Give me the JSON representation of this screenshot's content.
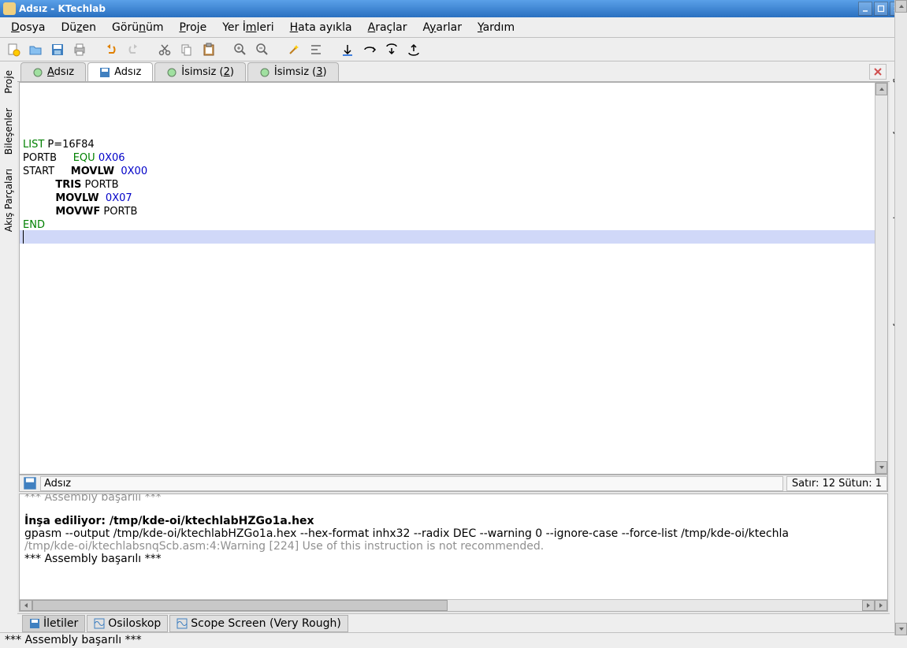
{
  "window": {
    "title": "Adsız - KTechlab"
  },
  "menus": {
    "file": "Dosya",
    "edit": "Düzen",
    "view": "Görünüm",
    "project": "Proje",
    "bookmarks": "Yer İmleri",
    "debug": "Hata ayıkla",
    "tools": "Araçlar",
    "settings": "Ayarlar",
    "help": "Yardım"
  },
  "toolbar_icons": {
    "new": "new-doc",
    "open": "open",
    "save": "save",
    "print": "print",
    "undo": "undo",
    "redo": "redo",
    "cut": "cut",
    "copy": "copy",
    "paste": "paste",
    "zoom_in": "zoom-in",
    "zoom_out": "zoom-out",
    "wizard": "wizard",
    "align": "align",
    "nav1": "nav-up",
    "nav2": "nav-brace1",
    "nav3": "nav-brace2",
    "nav4": "nav-brace3"
  },
  "doc_tabs": [
    {
      "label": "Adsız",
      "underline_first": "A",
      "rest": "dsız",
      "icon": "gear",
      "active": false
    },
    {
      "label": "Adsız",
      "underline_first": "",
      "rest": "Adsız",
      "icon": "save",
      "active": true
    },
    {
      "label": "İsimsiz (2)",
      "underline_first": "",
      "rest_pre": "İsimsiz (",
      "u": "2",
      "rest_post": ")",
      "icon": "gear",
      "active": false
    },
    {
      "label": "İsimsiz (3)",
      "underline_first": "",
      "rest_pre": "İsimsiz (",
      "u": "3",
      "rest_post": ")",
      "icon": "gear",
      "active": false
    }
  ],
  "left_side_tabs": [
    {
      "label": "Proje",
      "icon": "folder"
    },
    {
      "label": "Bileşenler",
      "icon": "chip"
    },
    {
      "label": "Akış Parçaları",
      "icon": "flow"
    }
  ],
  "right_side_tabs": [
    {
      "label": "Öğe Düzenleyici",
      "icon": "edit"
    },
    {
      "label": "Context Help",
      "icon": "help"
    },
    {
      "label": "Sembol Görüntüleyici",
      "icon": "symbol"
    }
  ],
  "code_lines": [
    {
      "segments": [
        {
          "t": "LIST",
          "c": "kw-green"
        },
        {
          "t": " P=16F84"
        }
      ]
    },
    {
      "segments": [
        {
          "t": "PORTB"
        },
        {
          "t": "     "
        },
        {
          "t": "EQU",
          "c": "kw-green"
        },
        {
          "t": " "
        },
        {
          "t": "0X06",
          "c": "kw-blue"
        }
      ]
    },
    {
      "segments": [
        {
          "t": "START     "
        },
        {
          "t": "MOVLW",
          "c": "kw-bold"
        },
        {
          "t": "  "
        },
        {
          "t": "0X00",
          "c": "kw-blue"
        }
      ]
    },
    {
      "segments": [
        {
          "t": "          "
        },
        {
          "t": "TRIS",
          "c": "kw-bold"
        },
        {
          "t": " PORTB"
        }
      ]
    },
    {
      "segments": [
        {
          "t": "          "
        },
        {
          "t": "MOVLW",
          "c": "kw-bold"
        },
        {
          "t": "  "
        },
        {
          "t": "0X07",
          "c": "kw-blue"
        }
      ]
    },
    {
      "segments": [
        {
          "t": "          "
        },
        {
          "t": "MOVWF",
          "c": "kw-bold"
        },
        {
          "t": " PORTB"
        }
      ]
    },
    {
      "segments": [
        {
          "t": "END",
          "c": "kw-green"
        }
      ]
    }
  ],
  "editor_status": {
    "filename": "Adsız",
    "position": "Satır: 12 Sütun: 1"
  },
  "output": {
    "faded_top": "*** Assembly başarılı ***",
    "building_label": "İnşa ediliyor:",
    "building_path": " /tmp/kde-oi/ktechlabHZGo1a.hex",
    "cmd": "gpasm --output /tmp/kde-oi/ktechlabHZGo1a.hex --hex-format inhx32 --radix DEC --warning 0 --ignore-case --force-list /tmp/kde-oi/ktechla",
    "warning": "/tmp/kde-oi/ktechlabsnqScb.asm:4:Warning [224] Use of this instruction is not recommended.",
    "success": "*** Assembly başarılı ***"
  },
  "bottom_tabs": [
    {
      "label": "İletiler",
      "icon": "save"
    },
    {
      "label": "Osiloskop",
      "icon": "scope"
    },
    {
      "label": "Scope Screen (Very Rough)",
      "icon": "scope"
    }
  ],
  "status_line": "*** Assembly başarılı ***"
}
